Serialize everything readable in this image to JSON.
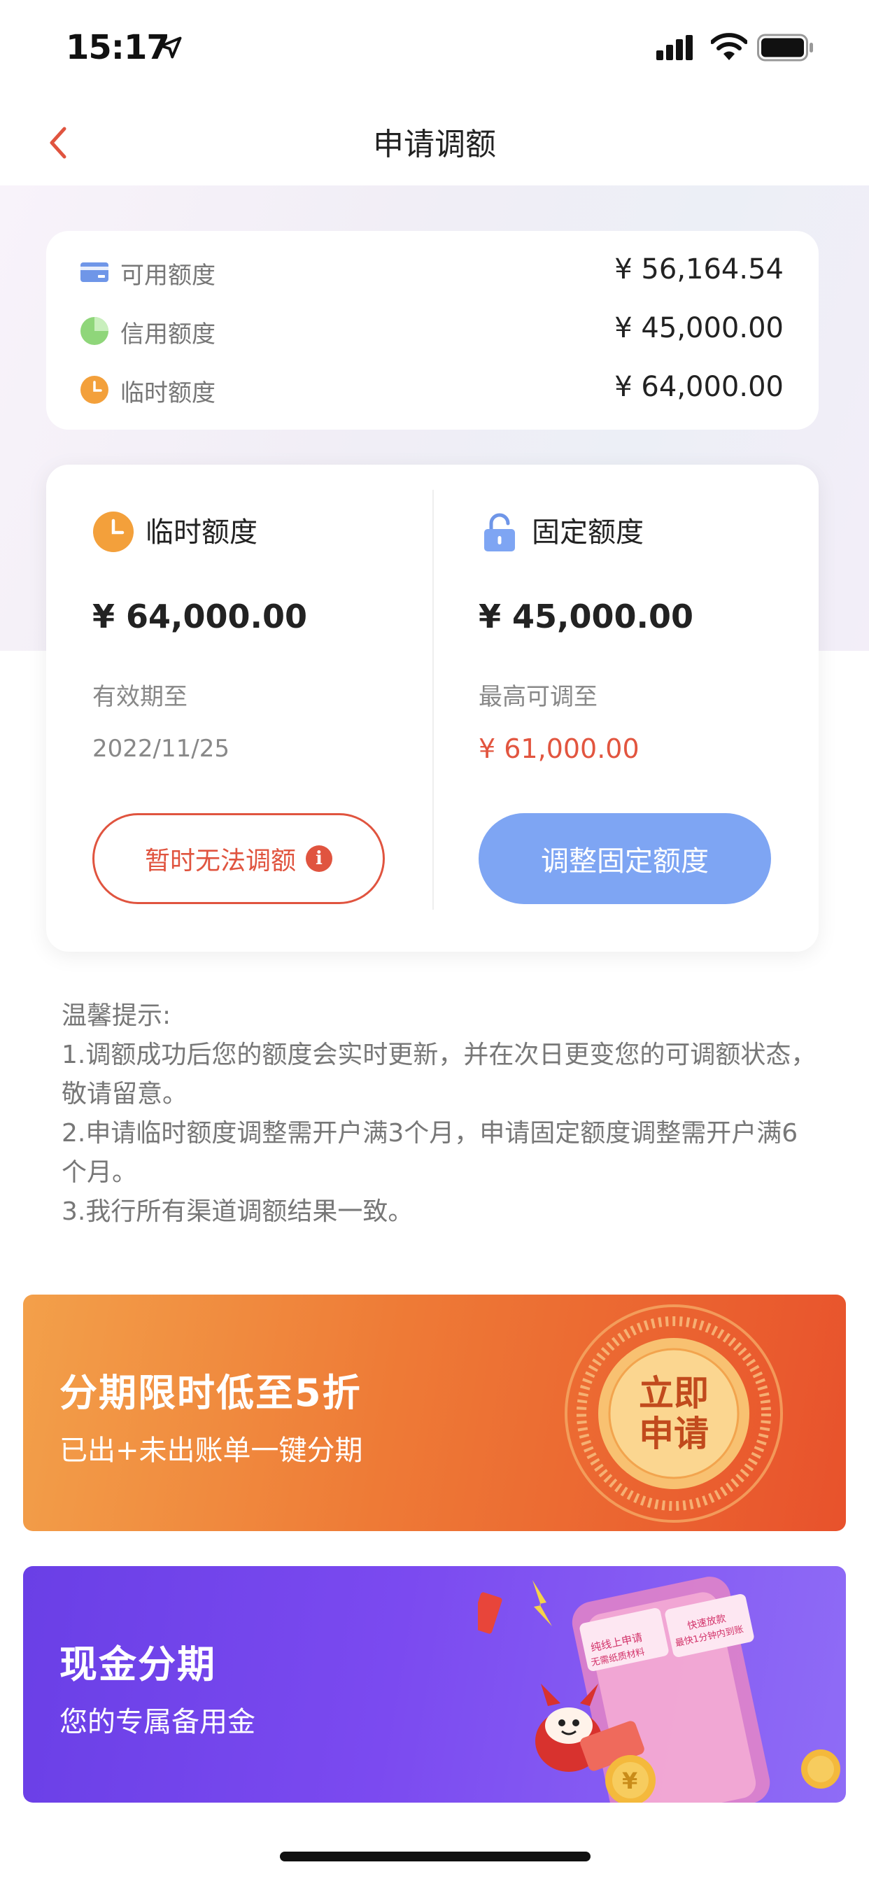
{
  "status_bar": {
    "time": "15:17"
  },
  "nav": {
    "title": "申请调额"
  },
  "summary": {
    "rows": [
      {
        "label": "可用额度",
        "value": "¥ 56,164.54",
        "icon": "card-icon"
      },
      {
        "label": "信用额度",
        "value": "¥ 45,000.00",
        "icon": "pie-icon"
      },
      {
        "label": "临时额度",
        "value": "¥ 64,000.00",
        "icon": "clock-icon"
      }
    ]
  },
  "detail": {
    "temporary": {
      "title": "临时额度",
      "amount": "¥ 64,000.00",
      "sub_label": "有效期至",
      "sub_value": "2022/11/25",
      "button": "暂时无法调额",
      "info_glyph": "i"
    },
    "fixed": {
      "title": "固定额度",
      "amount": "¥ 45,000.00",
      "sub_label": "最高可调至",
      "sub_value": "¥ 61,000.00",
      "button": "调整固定额度"
    }
  },
  "tips": {
    "heading": "温馨提示:",
    "items": [
      "1.调额成功后您的额度会实时更新，并在次日更变您的可调额状态，敬请留意。",
      "2.申请临时额度调整需开户满3个月，申请固定额度调整需开户满6个月。",
      "3.我行所有渠道调额结果一致。"
    ]
  },
  "banners": {
    "installment": {
      "title": "分期限时低至5折",
      "subtitle": "已出+未出账单一键分期",
      "badge_line1": "立即",
      "badge_line2": "申请"
    },
    "cash": {
      "title": "现金分期",
      "subtitle": "您的专属备用金",
      "art_caption1": "纯线上申请",
      "art_caption2": "无需纸质材料",
      "art_caption3": "快速放款",
      "art_caption4": "最快1分钟内到账"
    }
  },
  "colors": {
    "accent_red": "#e0543f",
    "accent_blue": "#7ea5f3",
    "banner_orange": "#ee7a36",
    "banner_purple": "#7b4af0"
  }
}
